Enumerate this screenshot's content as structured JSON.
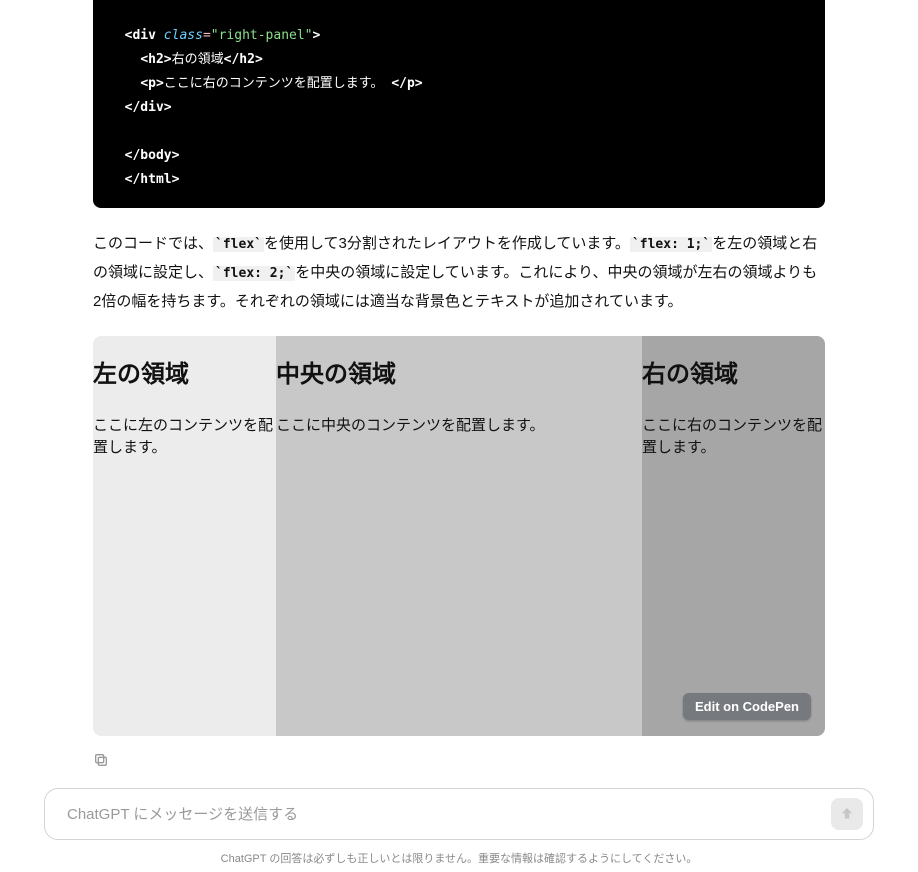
{
  "code": {
    "lines": [
      {
        "indent": "  ",
        "open": "      "
      },
      {
        "indent": "  ",
        "tag_open": "<div",
        "attr": " class",
        "eq": "=",
        "str": "\"right-panel\"",
        "tag_close": ">"
      },
      {
        "indent": "    ",
        "tag_open": "<h2>",
        "text": "右の領域",
        "tag_end": "</h2>"
      },
      {
        "indent": "    ",
        "tag_open": "<p>",
        "text": "ここに右のコンテンツを配置します。",
        "tag_end": "</p>"
      },
      {
        "indent": "  ",
        "tag_open": "</div>"
      },
      {
        "blank": true
      },
      {
        "indent": "  ",
        "tag_open": "</body>"
      },
      {
        "indent": "  ",
        "tag_open": "</html>"
      }
    ]
  },
  "explain": {
    "t1": "このコードでは、",
    "c1": "`flex`",
    "t2": "を使用して3分割されたレイアウトを作成しています。",
    "c2": "`flex: 1;`",
    "t3": "を左の領域と右の領域に設定し、",
    "c3": "`flex: 2;`",
    "t4": "を中央の領域に設定しています。これにより、中央の領域が左右の領域よりも2倍の幅を持ちます。それぞれの領域には適当な背景色とテキストが追加されています。"
  },
  "preview": {
    "left": {
      "title": "左の領域",
      "body": "ここに左のコンテンツを配置します。"
    },
    "center": {
      "title": "中央の領域",
      "body": "ここに中央のコンテンツを配置します。"
    },
    "right": {
      "title": "右の領域",
      "body": "ここに右のコンテンツを配置します。"
    },
    "edit_label": "Edit on CodePen"
  },
  "composer": {
    "placeholder": "ChatGPT にメッセージを送信する"
  },
  "disclaimer": "ChatGPT の回答は必ずしも正しいとは限りません。重要な情報は確認するようにしてください。"
}
